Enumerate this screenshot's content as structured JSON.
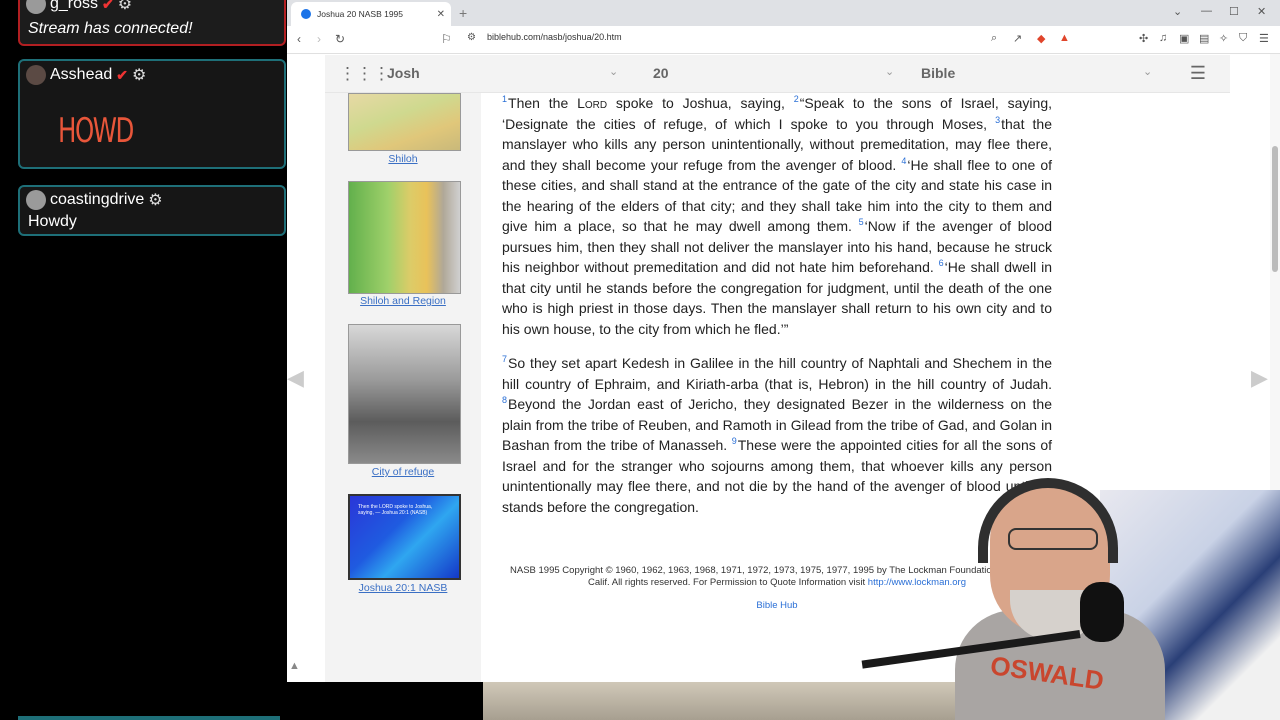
{
  "chat": {
    "messages": [
      {
        "user": "g_ross",
        "text": "Stream has connected!"
      },
      {
        "user": "Asshead",
        "text": "HOWD"
      },
      {
        "user": "coastingdrive",
        "text": "Howdy"
      }
    ]
  },
  "browser": {
    "tab_title": "Joshua 20 NASB 1995",
    "url": "biblehub.com/nasb/joshua/20.htm"
  },
  "nav": {
    "book": "Josh",
    "chapter": "20",
    "version": "Bible"
  },
  "sidebar": {
    "images": [
      {
        "caption": "Shiloh"
      },
      {
        "caption": "Shiloh and Region"
      },
      {
        "caption": "City of refuge"
      },
      {
        "caption": "Joshua 20:1 NASB",
        "image_text": "Then the LORD spoke to Joshua, saying, — Joshua 20:1 (NASB)"
      }
    ]
  },
  "content": {
    "para1": {
      "v1_num": "1",
      "v1_a": "Then the ",
      "v1_lord": "Lord",
      "v1_b": " spoke to Joshua, saying,",
      "v2_num": "2",
      "v2": "“Speak to the sons of Israel, saying, ‘Designate the cities of refuge, of which I spoke to you through Moses,",
      "v3_num": "3",
      "v3": "that the manslayer who kills any person unintentionally, without premeditation, may flee there, and they shall become your refuge from the avenger of blood.",
      "v4_num": "4",
      "v4": "‘He shall flee to one of these cities, and shall stand at the entrance of the gate of the city and state his case in the hearing of the elders of that city; and they shall take him into the city to them and give him a place, so that he may dwell among them.",
      "v5_num": "5",
      "v5": "‘Now if the avenger of blood pursues him, then they shall not deliver the manslayer into his hand, because he struck his neighbor without premeditation and did not hate him beforehand.",
      "v6_num": "6",
      "v6": "‘He shall dwell in that city until he stands before the congregation for judgment, until the death of the one who is high priest in those days. Then the manslayer shall return to his own city and to his own house, to the city from which he fled.’”"
    },
    "para2": {
      "v7_num": "7",
      "v7": "So they set apart Kedesh in Galilee in the hill country of Naphtali and Shechem in the hill country of Ephraim, and Kiriath-arba (that is, Hebron) in the hill country of Judah.",
      "v8_num": "8",
      "v8": "Beyond the Jordan east of Jericho, they designated Bezer in the wilderness on the plain from the tribe of Reuben, and Ramoth in Gilead from the tribe of Gad, and Golan in Bashan from the tribe of Manasseh.",
      "v9_num": "9",
      "v9": "These were the appointed cities for all the sons of Israel and for the stranger who sojourns among them, that whoever kills any person unintentionally may flee there, and not die by the hand of the avenger of blood until he stands before the congregation."
    },
    "copyright": "NASB 1995 Copyright © 1960, 1962, 1963, 1968, 1971, 1972, 1973, 1975, 1977, 1995 by The Lockman Foundation, La Habra, Calif. All rights reserved. For Permission to Quote Information visit",
    "copyright_link": "http://www.lockman.org",
    "footer_link": "Bible Hub"
  },
  "webcam": {
    "shirt_text": "OSWALD"
  }
}
